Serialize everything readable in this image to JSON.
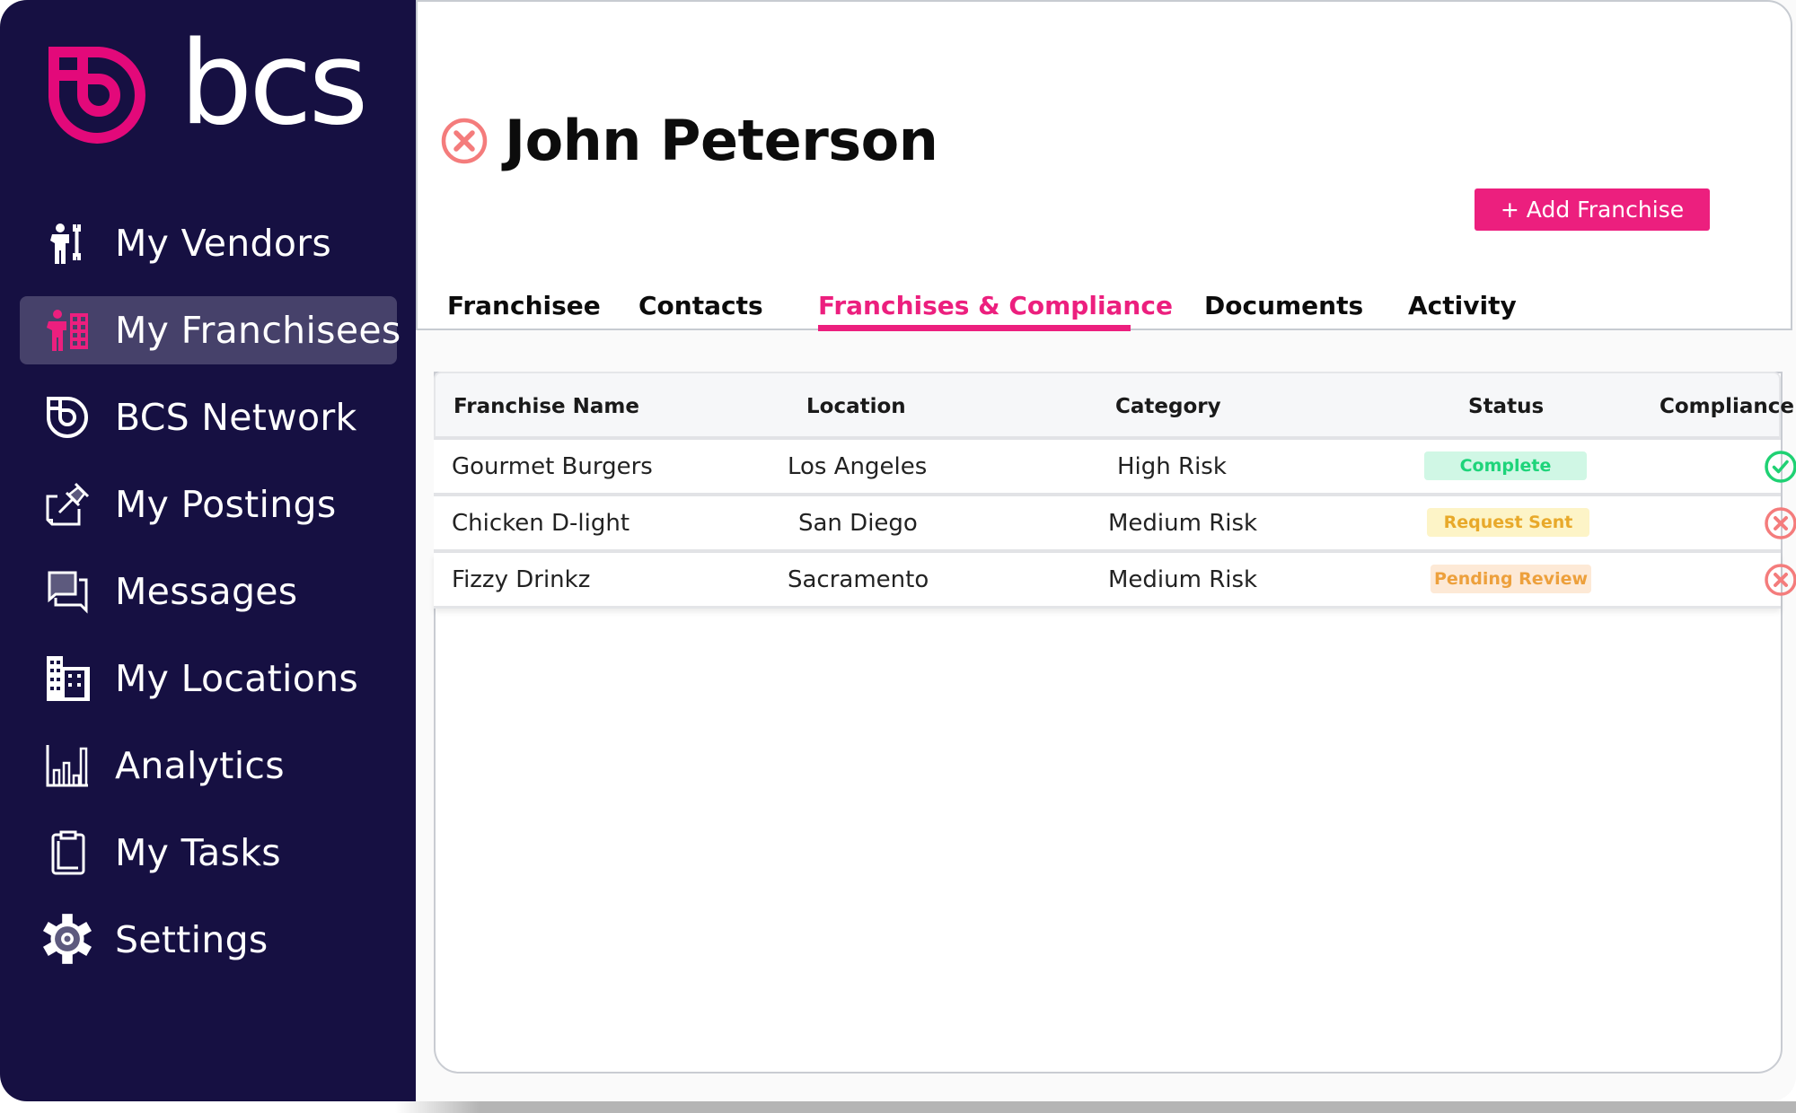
{
  "app": {
    "logo_text": "bcs",
    "brand_color": "#ec1f7e",
    "sidebar_color": "#161042"
  },
  "sidebar": {
    "items": [
      {
        "label": "My Vendors",
        "icon": "vendor-icon",
        "active": false
      },
      {
        "label": "My Franchisees",
        "icon": "franchisee-icon",
        "active": true
      },
      {
        "label": "BCS Network",
        "icon": "bcs-network-icon",
        "active": false
      },
      {
        "label": "My Postings",
        "icon": "posting-icon",
        "active": false
      },
      {
        "label": "Messages",
        "icon": "messages-icon",
        "active": false
      },
      {
        "label": "My Locations",
        "icon": "locations-icon",
        "active": false
      },
      {
        "label": "Analytics",
        "icon": "analytics-icon",
        "active": false
      },
      {
        "label": "My Tasks",
        "icon": "tasks-icon",
        "active": false
      },
      {
        "label": "Settings",
        "icon": "settings-icon",
        "active": false
      }
    ]
  },
  "header": {
    "title": "John Peterson",
    "status_icon": "non-compliant-icon",
    "add_button_label": "+ Add Franchise"
  },
  "tabs": [
    {
      "label": "Franchisee",
      "active": false
    },
    {
      "label": "Contacts",
      "active": false
    },
    {
      "label": "Franchises & Compliance",
      "active": true
    },
    {
      "label": "Documents",
      "active": false
    },
    {
      "label": "Activity",
      "active": false
    }
  ],
  "table": {
    "columns": [
      "Franchise Name",
      "Location",
      "Category",
      "Status",
      "Compliance"
    ],
    "rows": [
      {
        "name": "Gourmet Burgers",
        "location": "Los Angeles",
        "category": "High  Risk",
        "status": "Complete",
        "compliance": "compliant"
      },
      {
        "name": "Chicken D-light",
        "location": "San Diego",
        "category": "Medium Risk",
        "status": "Request Sent",
        "compliance": "non-compliant"
      },
      {
        "name": "Fizzy Drinkz",
        "location": "Sacramento",
        "category": "Medium Risk",
        "status": "Pending Review",
        "compliance": "non-compliant"
      }
    ]
  },
  "status_colors": {
    "Complete": {
      "bg": "#d0f7e5",
      "fg": "#1ed47a"
    },
    "Request Sent": {
      "bg": "#fdf4c7",
      "fg": "#e8a92a"
    },
    "Pending Review": {
      "bg": "#fde9d6",
      "fg": "#eda03c"
    }
  },
  "icon_colors": {
    "compliant": "#1fd173",
    "non-compliant": "#f47c7c"
  }
}
